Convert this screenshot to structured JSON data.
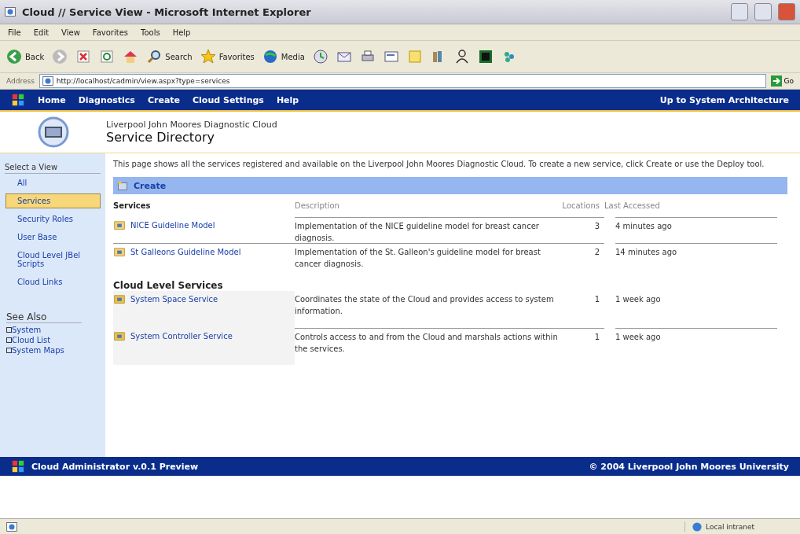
{
  "window": {
    "title": "Cloud // Service View - Microsoft Internet Explorer"
  },
  "menu_bar": [
    "File",
    "Edit",
    "View",
    "Favorites",
    "Tools",
    "Help"
  ],
  "toolbar": [
    {
      "kind": "back",
      "label": "Back"
    },
    {
      "kind": "forward"
    },
    {
      "kind": "stop"
    },
    {
      "kind": "refresh"
    },
    {
      "kind": "home"
    },
    {
      "kind": "search",
      "label": "Search"
    },
    {
      "kind": "favorites",
      "label": "Favorites"
    },
    {
      "kind": "media",
      "label": "Media"
    },
    {
      "kind": "history"
    },
    {
      "kind": "mail"
    },
    {
      "kind": "print"
    },
    {
      "kind": "edit"
    },
    {
      "kind": "folder"
    },
    {
      "kind": "research"
    },
    {
      "kind": "messenger"
    },
    {
      "kind": "shield"
    },
    {
      "kind": "people"
    }
  ],
  "address_bar": {
    "label": "Address",
    "value": "http://localhost/cadmin/view.aspx?type=services",
    "go": "Go"
  },
  "nav": {
    "items": [
      "Home",
      "Diagnostics",
      "Create",
      "Cloud Settings",
      "Help"
    ],
    "right_link": "Up to System Architecture"
  },
  "header": {
    "subtitle": "Liverpool John Moores Diagnostic Cloud",
    "title": "Service Directory"
  },
  "sidebar": {
    "heading": "Select a View",
    "items": [
      {
        "label": "All",
        "selected": false
      },
      {
        "label": "Services",
        "selected": true
      },
      {
        "label": "Security Roles",
        "selected": false
      },
      {
        "label": "User Base",
        "selected": false
      },
      {
        "label": "Cloud Level JBel Scripts",
        "selected": false
      },
      {
        "label": "Cloud Links",
        "selected": false
      }
    ],
    "see_also_heading": "See Also",
    "see_also": [
      "System",
      "Cloud List",
      "System Maps"
    ]
  },
  "content": {
    "intro": "This page shows all the services registered and available on the Liverpool John Moores Diagnostic Cloud. To create a new service, click Create or use the Deploy tool.",
    "create": "Create",
    "columns": [
      "Services",
      "Description",
      "Locations",
      "Last Accessed"
    ],
    "rows": [
      {
        "name": "NICE Guideline Model",
        "description": "Implementation of the NICE guideline model for breast cancer diagnosis.",
        "locations": "3",
        "last_accessed": "4 minutes ago"
      },
      {
        "name": "St Galleons Guideline Model",
        "description": "Implementation of the St. Galleon's guideline model for breast cancer diagnosis.",
        "locations": "2",
        "last_accessed": "14 minutes ago"
      }
    ],
    "section": "Cloud Level Services",
    "cloud_rows": [
      {
        "name": "System Space Service",
        "description": "Coordinates the state of the Cloud and provides access to system information.",
        "locations": "1",
        "last_accessed": "1 week ago"
      },
      {
        "name": "System Controller Service",
        "description": "Controls access to and from the Cloud and marshals actions within the services.",
        "locations": "1",
        "last_accessed": "1 week ago"
      }
    ]
  },
  "footer": {
    "left": "Cloud Administrator v.0.1 Preview",
    "right": "© 2004 Liverpool John Moores University"
  },
  "status_bar": {
    "zone": "Local intranet"
  }
}
